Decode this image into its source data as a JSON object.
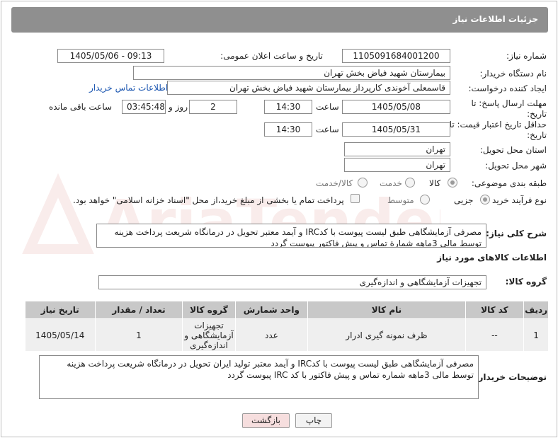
{
  "header": {
    "title": "جزئیات اطلاعات نیاز"
  },
  "fields": {
    "need_number": {
      "label": "شماره نیاز:",
      "value": "1105091684001200"
    },
    "announce_datetime": {
      "label": "تاریخ و ساعت اعلان عمومی:",
      "value": "1405/05/06 - 09:13"
    },
    "buyer_org": {
      "label": "نام دستگاه خریدار:",
      "value": "بیمارستان شهید فیاض بخش تهران"
    },
    "requester": {
      "label": "ایجاد کننده درخواست:",
      "value": "قاسمعلی آخوندی کارپرداز بیمارستان شهید فیاض بخش تهران",
      "contact_link": "اطلاعات تماس خریدار"
    },
    "reply_deadline": {
      "label": "مهلت ارسال پاسخ: تا تاریخ:",
      "date": "1405/05/08",
      "time_label": "ساعت",
      "time": "14:30",
      "days": "2",
      "days_label": "روز و",
      "remaining": "03:45:48",
      "remaining_label": "ساعت باقی مانده"
    },
    "price_validity": {
      "label": "حداقل تاریخ اعتبار قیمت: تا تاریخ:",
      "date": "1405/05/31",
      "time_label": "ساعت",
      "time": "14:30"
    },
    "delivery_province": {
      "label": "استان محل تحویل:",
      "value": "تهران"
    },
    "delivery_city": {
      "label": "شهر محل تحویل:",
      "value": "تهران"
    },
    "category": {
      "label": "طبقه بندی موضوعی:",
      "options": [
        "کالا",
        "خدمت",
        "کالا/خدمت"
      ],
      "selected": "کالا"
    },
    "purchase_type": {
      "label": "نوع فرآیند خرید :",
      "options": [
        "جزیی",
        "متوسط"
      ],
      "selected": "جزیی",
      "payment_note": "پرداخت تمام یا بخشی از مبلغ خرید،از محل \"اسناد خزانه اسلامی\" خواهد بود."
    }
  },
  "summary": {
    "label": "شرح کلی نیاز:",
    "text": "مصرفی آزمایشگاهی طبق لیست پیوست با کدIRC و آیمد معتبر تحویل در درمانگاه شریعت پرداخت هزینه توسط مالی 3ماهه شمارة تماس و پیش فاکتور پیوست گردد"
  },
  "goods": {
    "heading": "اطلاعات کالاهای مورد نیاز",
    "group_label": "گروه کالا:",
    "group_value": "تجهیزات آزمایشگاهی و اندازه‌گیری",
    "columns": [
      "ردیف",
      "کد کالا",
      "نام کالا",
      "واحد شمارش",
      "گروه کالا",
      "تعداد / مقدار",
      "تاریخ نیاز"
    ],
    "rows": [
      {
        "row": "1",
        "code": "--",
        "name": "ظرف نمونه گیری ادرار",
        "unit": "عدد",
        "group": "تجهیزات آزمایشگاهی و اندازه‌گیری",
        "qty": "1",
        "date": "1405/05/14"
      }
    ]
  },
  "buyer_notes": {
    "label": "توضیحات خریدار:",
    "text": "مصرفی آزمایشگاهی طبق لیست پیوست با کدIRC و آیمد معتبر تولید ایران تحویل در درمانگاه شریعت پرداخت هزینه توسط مالی 3ماهه شماره تماس و پیش فاکتور با کد IRC پیوست گردد"
  },
  "buttons": {
    "print": "چاپ",
    "back": "بازگشت"
  },
  "watermark": {
    "text": "AriaTender.net"
  },
  "colors": {
    "title_bar": "#8f8f8f",
    "link": "#1a55b0",
    "table_header": "#c8c8c8",
    "back_button": "#f6dede"
  }
}
